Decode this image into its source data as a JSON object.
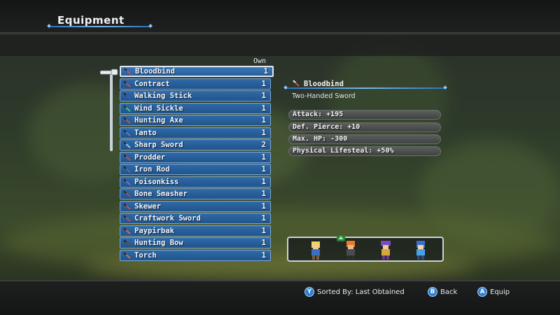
{
  "header": {
    "title": "Equipment"
  },
  "list": {
    "own_label": "Own",
    "items": [
      {
        "name": "Bloodbind",
        "qty": "1",
        "icon": "greatsword-icon",
        "color": "#d34b4b",
        "selected": true
      },
      {
        "name": "Contract",
        "qty": "1",
        "icon": "sword-icon",
        "color": "#c45050"
      },
      {
        "name": "Walking Stick",
        "qty": "1",
        "icon": "staff-icon",
        "color": "#3f5ea8"
      },
      {
        "name": "Wind Sickle",
        "qty": "1",
        "icon": "sickle-icon",
        "color": "#4cc37d"
      },
      {
        "name": "Hunting Axe",
        "qty": "1",
        "icon": "axe-icon",
        "color": "#c84f3c"
      },
      {
        "name": "Tanto",
        "qty": "1",
        "icon": "dagger-icon",
        "color": "#5a78b8"
      },
      {
        "name": "Sharp Sword",
        "qty": "2",
        "icon": "sword-icon",
        "color": "#9fc4e8"
      },
      {
        "name": "Prodder",
        "qty": "1",
        "icon": "spear-icon",
        "color": "#c45050"
      },
      {
        "name": "Iron Rod",
        "qty": "1",
        "icon": "rod-icon",
        "color": "#5c6f9a"
      },
      {
        "name": "Poisonkiss",
        "qty": "1",
        "icon": "dagger-icon",
        "color": "#8a6bb5"
      },
      {
        "name": "Bone Smasher",
        "qty": "1",
        "icon": "club-icon",
        "color": "#b24a4a"
      },
      {
        "name": "Skewer",
        "qty": "1",
        "icon": "spear-icon",
        "color": "#c45050"
      },
      {
        "name": "Craftwork Sword",
        "qty": "1",
        "icon": "sword-icon",
        "color": "#c45050"
      },
      {
        "name": "Paypirbak",
        "qty": "1",
        "icon": "book-icon",
        "color": "#d86a5a"
      },
      {
        "name": "Hunting Bow",
        "qty": "1",
        "icon": "bow-icon",
        "color": "#6b4a3a"
      },
      {
        "name": "Torch",
        "qty": "1",
        "icon": "torch-icon",
        "color": "#d8743a"
      }
    ]
  },
  "detail": {
    "name": "Bloodbind",
    "type": "Two-Handed Sword",
    "stats": [
      "Attack:  +195",
      "Def. Pierce:  +10",
      "Max. HP:  -300",
      "Physical Lifesteal:  +50%"
    ]
  },
  "party": {
    "members": [
      "blonde-hero-sprite",
      "orange-hair-sprite",
      "purple-hat-sprite",
      "blue-knight-sprite"
    ],
    "can_equip_marker": "green-up-arrow-icon"
  },
  "hints": {
    "sort": {
      "button": "Y",
      "label": "Sorted By: Last Obtained"
    },
    "back": {
      "button": "B",
      "label": "Back"
    },
    "equip": {
      "button": "A",
      "label": "Equip"
    }
  }
}
